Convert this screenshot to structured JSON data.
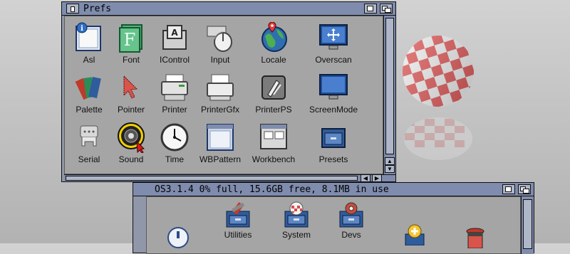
{
  "prefs_window": {
    "title": "Prefs",
    "icons": [
      {
        "label": "Asl",
        "icon": "asl-prefs-icon"
      },
      {
        "label": "Font",
        "icon": "font-prefs-icon"
      },
      {
        "label": "IControl",
        "icon": "icontrol-prefs-icon"
      },
      {
        "label": "Input",
        "icon": "input-prefs-icon"
      },
      {
        "label": "Locale",
        "icon": "locale-globe-icon"
      },
      {
        "label": "Overscan",
        "icon": "overscan-monitor-icon"
      },
      {
        "label": "Palette",
        "icon": "palette-icon"
      },
      {
        "label": "Pointer",
        "icon": "pointer-prefs-icon"
      },
      {
        "label": "Printer",
        "icon": "printer-icon"
      },
      {
        "label": "PrinterGfx",
        "icon": "printergfx-icon"
      },
      {
        "label": "PrinterPS",
        "icon": "printerps-icon"
      },
      {
        "label": "ScreenMode",
        "icon": "screenmode-monitor-icon"
      },
      {
        "label": "Serial",
        "icon": "serial-port-icon"
      },
      {
        "label": "Sound",
        "icon": "sound-speaker-icon"
      },
      {
        "label": "Time",
        "icon": "clock-icon"
      },
      {
        "label": "WBPattern",
        "icon": "wbpattern-icon"
      },
      {
        "label": "Workbench",
        "icon": "workbench-window-icon"
      },
      {
        "label": "Presets",
        "icon": "presets-drawer-icon"
      }
    ]
  },
  "disk_window": {
    "title": "OS3.1.4  0% full, 15.6GB free, 8.1MB in use",
    "icons": [
      {
        "label": "Utilities",
        "icon": "utilities-drawer-icon"
      },
      {
        "label": "System",
        "icon": "system-drawer-icon"
      },
      {
        "label": "Devs",
        "icon": "devs-drawer-icon"
      }
    ]
  },
  "colors": {
    "window_title": "#7f8cad",
    "window_bg": "#a5a5a5",
    "ball_red": "#e45a5a",
    "ball_white": "#f4f4f4"
  }
}
